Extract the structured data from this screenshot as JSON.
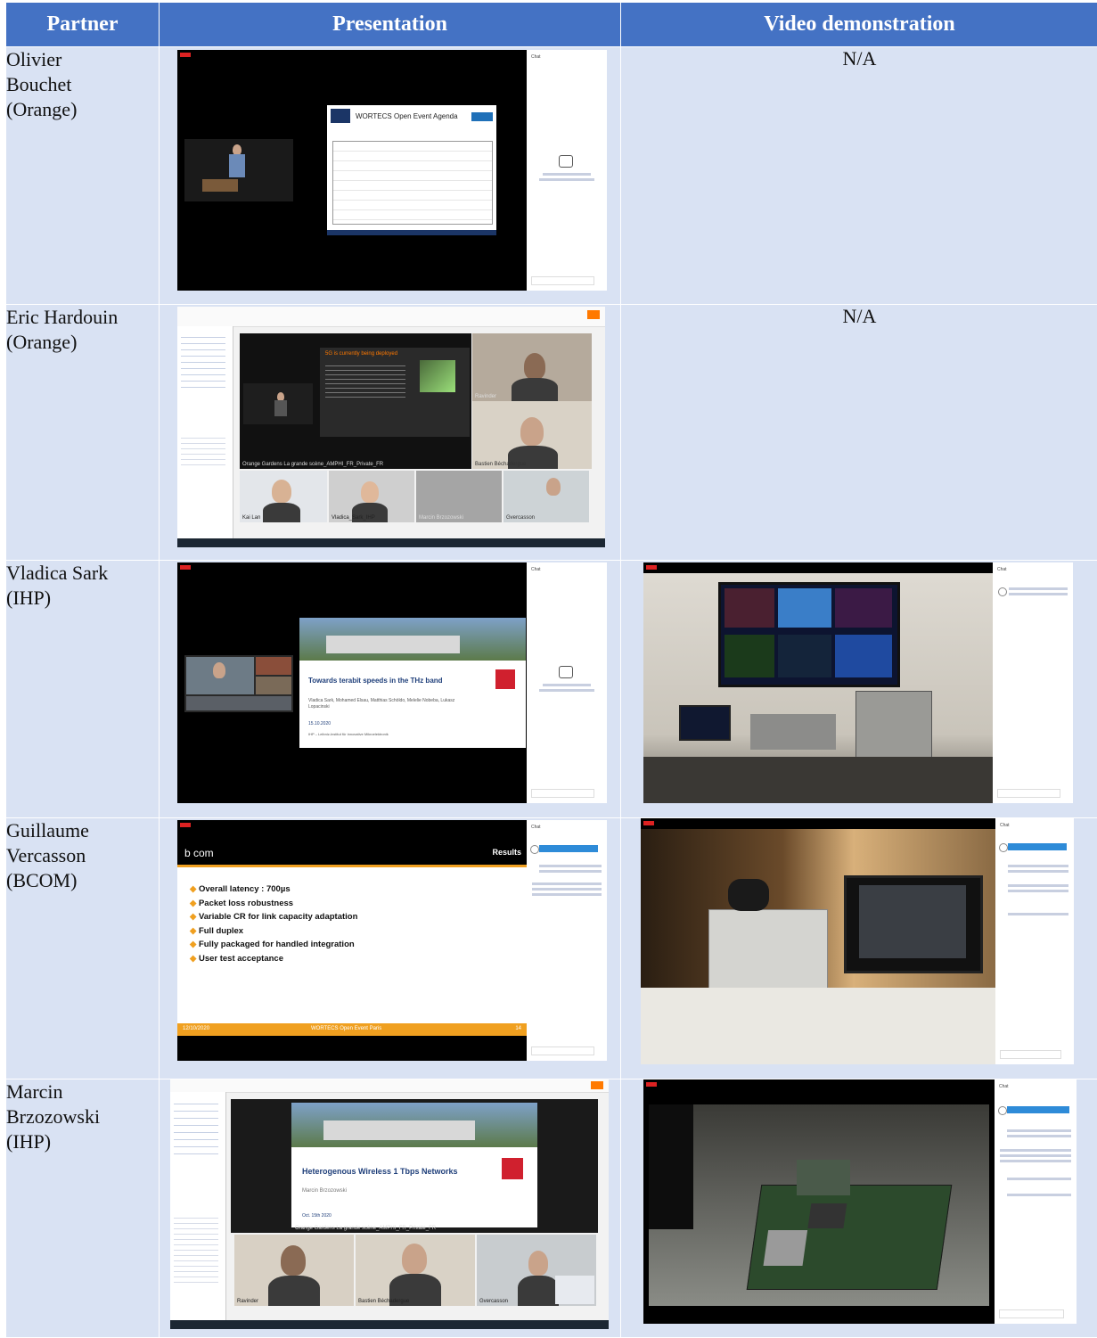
{
  "table": {
    "headers": {
      "partner": "Partner",
      "presentation": "Presentation",
      "video": "Video demonstration"
    },
    "rows": [
      {
        "partner": [
          "Olivier",
          "Bouchet",
          "(Orange)"
        ],
        "video": "N/A"
      },
      {
        "partner": [
          "Eric Hardouin",
          "(Orange)"
        ],
        "video": "N/A"
      },
      {
        "partner": [
          "Vladica Sark",
          "(IHP)"
        ],
        "video": ""
      },
      {
        "partner": [
          "Guillaume",
          "Vercasson",
          "(BCOM)"
        ],
        "video": ""
      },
      {
        "partner": [
          "Marcin",
          "Brzozowski",
          "(IHP)"
        ],
        "video": ""
      }
    ]
  },
  "screens": {
    "row1": {
      "chat_title": "Chat",
      "slide_title": "WORTECS Open Event Agenda"
    },
    "row2": {
      "slide_title": "5G is currently being deployed",
      "stage_label": "Orange Gardens La grande scène_AMPHI_FR_Private_FR",
      "tiles": [
        "Ravinder",
        "Bastien Béchadergue",
        "Kai Lan",
        "Vladica_Sark_IHP",
        "Marcin Brzozowski",
        "Gvercasson"
      ]
    },
    "row3": {
      "chat_title": "Chat",
      "slide_title": "Towards terabit speeds in the THz band",
      "slide_authors": "Vladica Sark, Mohamed Elsau, Matthias Schöldo, Melelie Nobeba, Lukasz Lopacinski",
      "slide_date": "15.10.2020",
      "slide_footer": "IHP – Leibniz-Institut für innovative Mikroelektronik"
    },
    "row4": {
      "chat_title": "Chat",
      "logo": "b com",
      "slide_title": "Results",
      "bullets": [
        "Overall latency : 700µs",
        "Packet loss robustness",
        "Variable CR for link capacity adaptation",
        "Full duplex",
        "Fully packaged for handled integration",
        "User test acceptance"
      ],
      "footer_date": "12/10/2020",
      "footer_event": "WORTECS Open Event Paris",
      "footer_page": "14"
    },
    "row5": {
      "chat_title": "Chat",
      "slide_title": "Heterogenous Wireless 1 Tbps Networks",
      "slide_author": "Marcin Brzozowski",
      "slide_date": "Oct. 15th 2020",
      "stage_label": "Orange Gardens La grande scène_AMPHI_FR_Private_FR",
      "tiles": [
        "Ravinder",
        "Bastien Béchadergue",
        "Gvercasson"
      ]
    }
  }
}
